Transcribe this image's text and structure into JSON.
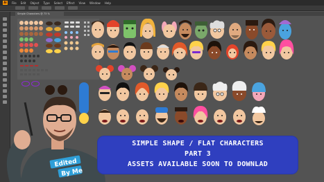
{
  "app": {
    "logo": "Ai",
    "menus": [
      "File",
      "Edit",
      "Object",
      "Type",
      "Select",
      "Effect",
      "View",
      "Window",
      "Help"
    ],
    "document_tab": "Simple Characters @ 73 % (RGB/Preview)"
  },
  "colors": {
    "ui_dark": "#2b2b2b",
    "canvas": "#535353",
    "banner": "#2f3fbf"
  },
  "banner": {
    "line1": "SIMPLE SHAPE / FLAT CHARACTERS",
    "line2": "PART 3",
    "line3": "ASSETS AVAILABLE SOON TO DOWNLAD"
  },
  "presenter": {
    "shirt_text_1": "Edited",
    "shirt_text_2": "By Me"
  }
}
